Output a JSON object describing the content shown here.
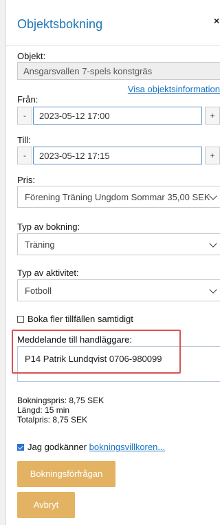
{
  "dialog": {
    "title": "Objektsbokning",
    "close": "×"
  },
  "object": {
    "label": "Objekt:",
    "value": "Ansgarsvallen 7-spels konstgräs",
    "info_link": "Visa objektsinformation"
  },
  "from": {
    "label": "Från:",
    "minus": "-",
    "plus": "+",
    "value": "2023-05-12 17:00"
  },
  "to": {
    "label": "Till:",
    "minus": "-",
    "plus": "+",
    "value": "2023-05-12 17:15"
  },
  "price": {
    "label": "Pris:",
    "selected": "Förening Träning Ungdom Sommar 35,00 SEK"
  },
  "booking_type": {
    "label": "Typ av bokning:",
    "selected": "Träning"
  },
  "activity_type": {
    "label": "Typ av aktivitet:",
    "selected": "Fotboll"
  },
  "multi": {
    "label": "Boka fler tillfällen samtidigt",
    "checked": false
  },
  "message": {
    "label": "Meddelande till handläggare:",
    "value": "P14 Patrik Lundqvist 0706-980099"
  },
  "summary": {
    "booking_price": "Bokningspris: 8,75 SEK",
    "length": "Längd: 15 min",
    "total": "Totalpris: 8,75 SEK"
  },
  "terms": {
    "prefix": "Jag godkänner ",
    "link": "bokningsvillkoren...",
    "checked": true
  },
  "buttons": {
    "request": "Bokningsförfrågan",
    "cancel": "Avbryt"
  },
  "colors": {
    "title_blue": "#1f77b4",
    "link_blue": "#1a73c4",
    "button_orange": "#e3b363",
    "highlight_red": "#d9534f"
  }
}
